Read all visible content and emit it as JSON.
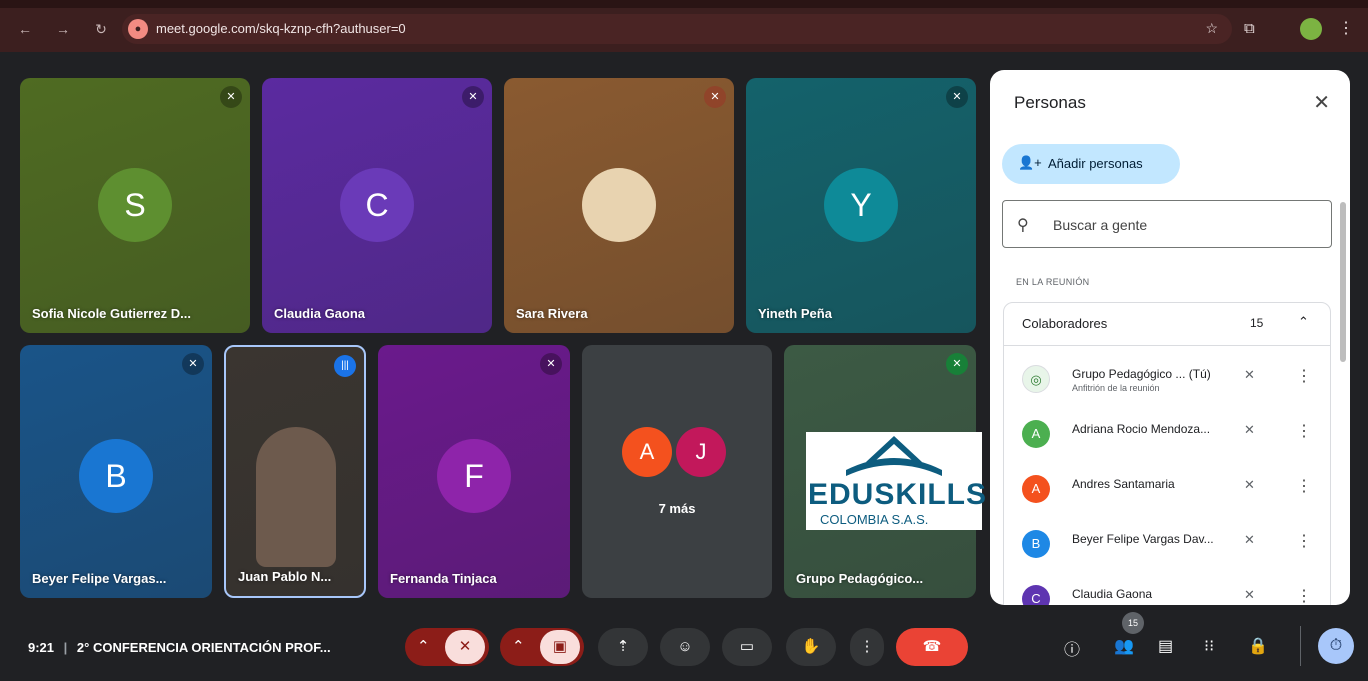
{
  "browser": {
    "url": "meet.google.com/skq-kznp-cfh?authuser=0"
  },
  "tiles": [
    {
      "name": "Sofia Nicole Gutierrez D...",
      "initial": "S",
      "bg": "#4f6b22",
      "avatar_color": "#5e8f30"
    },
    {
      "name": "Claudia Gaona",
      "initial": "C",
      "bg": "#5b2aa0",
      "avatar_color": "#6a3ab8"
    },
    {
      "name": "Sara Rivera",
      "initial": "",
      "bg": "#8a5a30"
    },
    {
      "name": "Yineth Peña",
      "initial": "Y",
      "bg": "#14626b",
      "avatar_color": "#0e8a98"
    },
    {
      "name": "Beyer Felipe Vargas...",
      "initial": "B",
      "bg": "#1a5488",
      "avatar_color": "#1976d2"
    },
    {
      "name": "Juan Pablo N...",
      "initial": "",
      "bg": "#3a3530"
    },
    {
      "name": "Fernanda Tinjaca",
      "initial": "F",
      "bg": "#6a1a8c",
      "avatar_color": "#8e24aa"
    },
    {
      "name": "Grupo Pedagógico...",
      "initial": "",
      "bg": "#3c5a44"
    }
  ],
  "more_tile": {
    "label": "7 más",
    "a": "A",
    "j": "J"
  },
  "logo": {
    "word": "EDUSKILLS",
    "sub": "COLOMBIA S.A.S."
  },
  "panel": {
    "title": "Personas",
    "add_label": "Añadir personas",
    "search_placeholder": "Buscar a gente",
    "section": "EN LA REUNIÓN",
    "group_name": "Colaboradores",
    "group_count": "15",
    "people": [
      {
        "name": "Grupo Pedagógico ... (Tú)",
        "sub": "Anfitrión de la reunión",
        "initial": "",
        "color": "#ffffff"
      },
      {
        "name": "Adriana Rocio Mendoza...",
        "sub": "",
        "initial": "A",
        "color": "#4caf50"
      },
      {
        "name": "Andres Santamaria",
        "sub": "",
        "initial": "A",
        "color": "#f4511e"
      },
      {
        "name": "Beyer Felipe Vargas Dav...",
        "sub": "",
        "initial": "B",
        "color": "#1e88e5"
      },
      {
        "name": "Claudia Gaona",
        "sub": "",
        "initial": "C",
        "color": "#5e35b1"
      }
    ]
  },
  "bottom": {
    "clock": "9:21",
    "meeting_title": "2° CONFERENCIA ORIENTACIÓN PROF...",
    "participant_badge": "15"
  },
  "colors": {
    "hangup": "#ea4335",
    "muted_bg": "#f9dedc",
    "control_bg": "#333537"
  }
}
